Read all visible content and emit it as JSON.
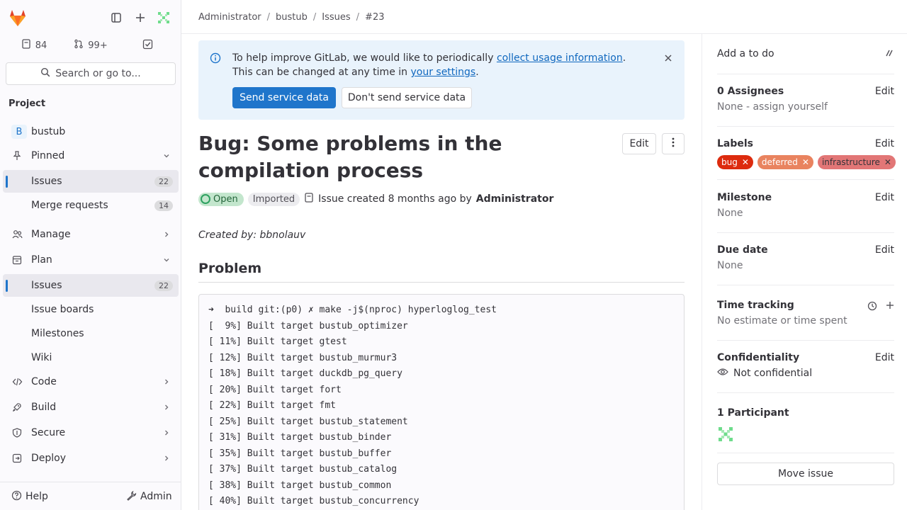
{
  "sidebar": {
    "counters": [
      {
        "icon": "issues-icon",
        "value": "84"
      },
      {
        "icon": "merge-request-icon",
        "value": "99+"
      },
      {
        "icon": "todo-icon",
        "value": ""
      }
    ],
    "search_label": "Search or go to...",
    "section_title": "Project",
    "project_avatar": "B",
    "items": [
      {
        "label": "bustub"
      },
      {
        "label": "Pinned"
      },
      {
        "label": "Issues",
        "count": "22"
      },
      {
        "label": "Merge requests",
        "count": "14"
      },
      {
        "label": "Manage"
      },
      {
        "label": "Plan"
      },
      {
        "label": "Issues",
        "count": "22"
      },
      {
        "label": "Issue boards"
      },
      {
        "label": "Milestones"
      },
      {
        "label": "Wiki"
      },
      {
        "label": "Code"
      },
      {
        "label": "Build"
      },
      {
        "label": "Secure"
      },
      {
        "label": "Deploy"
      }
    ],
    "help_label": "Help",
    "admin_label": "Admin"
  },
  "breadcrumb": [
    "Administrator",
    "bustub",
    "Issues",
    "#23"
  ],
  "banner": {
    "text_before": "To help improve GitLab, we would like to periodically ",
    "link1": "collect usage information",
    "text_middle": ". This can be changed at any time in ",
    "link2": "your settings",
    "text_after": ".",
    "primary_button": "Send service data",
    "secondary_button": "Don't send service data"
  },
  "issue": {
    "title": "Bug: Some problems in the compilation process",
    "edit_label": "Edit",
    "status": "Open",
    "imported": "Imported",
    "created_text": "Issue created 8 months ago by",
    "author": "Administrator",
    "created_by": "Created by: bbnolauv",
    "heading": "Problem",
    "code_lines": [
      "➜  build git:(p0) ✗ make -j$(nproc) hyperloglog_test",
      "[  9%] Built target bustub_optimizer",
      "[ 11%] Built target gtest",
      "[ 12%] Built target bustub_murmur3",
      "[ 18%] Built target duckdb_pg_query",
      "[ 20%] Built target fort",
      "[ 22%] Built target fmt",
      "[ 25%] Built target bustub_statement",
      "[ 31%] Built target bustub_binder",
      "[ 35%] Built target bustub_buffer",
      "[ 37%] Built target bustub_catalog",
      "[ 38%] Built target bustub_common",
      "[ 40%] Built target bustub_concurrency"
    ]
  },
  "right_sidebar": {
    "todo_label": "Add a to do",
    "assignees_title": "0 Assignees",
    "assignees_value": "None - assign yourself",
    "edit_label": "Edit",
    "labels_title": "Labels",
    "labels": [
      {
        "name": "bug",
        "color": "#dd2b0e"
      },
      {
        "name": "deferred",
        "color": "#e9835f"
      },
      {
        "name": "infrastructure",
        "color": "#e27676"
      }
    ],
    "milestone_title": "Milestone",
    "milestone_value": "None",
    "due_date_title": "Due date",
    "due_date_value": "None",
    "time_tracking_title": "Time tracking",
    "time_tracking_value": "No estimate or time spent",
    "confidentiality_title": "Confidentiality",
    "confidentiality_value": "Not confidential",
    "participants_title": "1 Participant",
    "move_label": "Move issue"
  },
  "colors": {
    "accent": "#1f75cb",
    "open_badge": "#c3e6cd",
    "banner_bg": "#e9f3fc"
  }
}
